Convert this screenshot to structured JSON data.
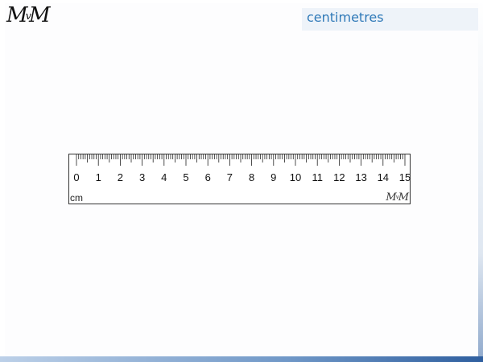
{
  "header": {
    "logo": "MvM",
    "title": "centimetres"
  },
  "ruler": {
    "unit": "cm",
    "logo": "MvM",
    "min": 0,
    "max": 15,
    "minor_divisions": 10,
    "numbers": [
      "0",
      "1",
      "2",
      "3",
      "4",
      "5",
      "6",
      "7",
      "8",
      "9",
      "10",
      "11",
      "12",
      "13",
      "14",
      "15"
    ]
  }
}
